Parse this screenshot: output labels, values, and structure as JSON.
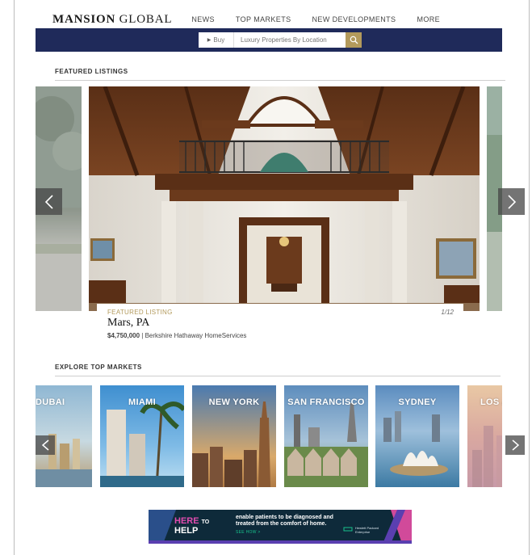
{
  "header": {
    "logo_part1": "MANSION",
    "logo_part2": "GLOBAL",
    "nav": [
      "NEWS",
      "TOP MARKETS",
      "NEW DEVELOPMENTS",
      "MORE"
    ]
  },
  "search": {
    "buy_label": "Buy",
    "placeholder": "Luxury Properties By Location"
  },
  "featured": {
    "section_title": "FEATURED LISTINGS",
    "label": "FEATURED LISTING",
    "counter": "1/12",
    "title": "Mars, PA",
    "price": "$4,750,000",
    "separator": "|",
    "agency": "Berkshire Hathaway HomeServices"
  },
  "markets": {
    "section_title": "EXPLORE TOP MARKETS",
    "items": [
      "DUBAI",
      "MIAMI",
      "NEW YORK",
      "SAN FRANCISCO",
      "SYDNEY",
      "LOS ANGELES"
    ]
  },
  "ad": {
    "logo_word1": "HERE",
    "logo_word2": "TO",
    "logo_word3": "HELP",
    "text": "enable patients to be diagnosed and treated from the comfort of home.",
    "cta": "SEE HOW >",
    "brand_line1": "Hewlett Packard",
    "brand_line2": "Enterprise"
  },
  "colors": {
    "navy": "#1f2a5a",
    "gold": "#b39a5c"
  }
}
